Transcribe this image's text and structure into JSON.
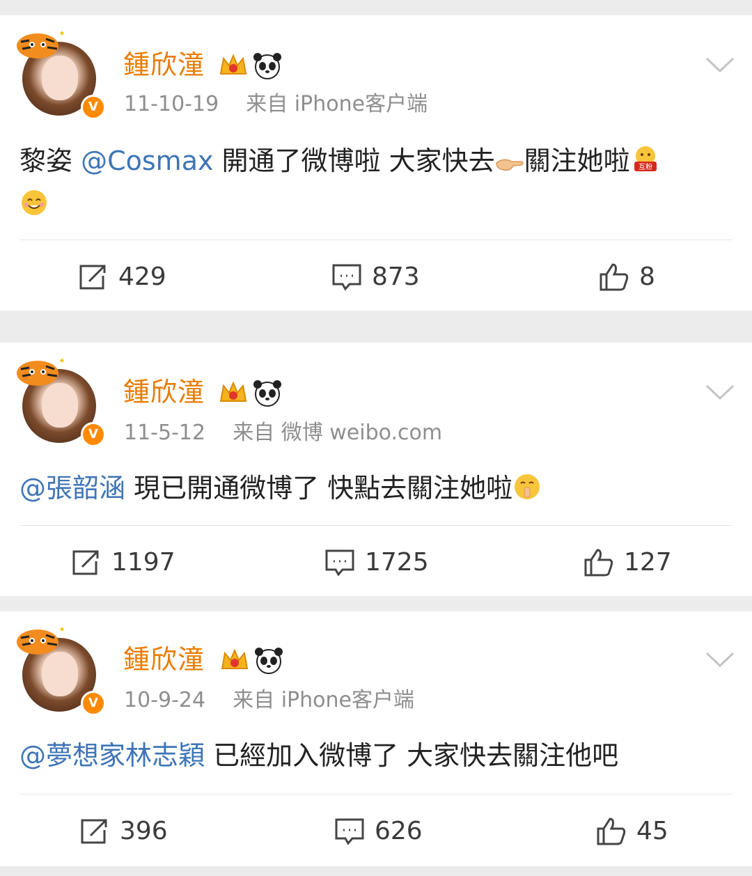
{
  "posts": [
    {
      "author": "鍾欣潼",
      "date": "11-10-19",
      "source": "来自 iPhone客户端",
      "mention": "@Cosmax",
      "text_before": "黎姿 ",
      "text_mid": " 開通了微博啦 大家快去",
      "text_after": "關注她啦",
      "reposts": "429",
      "comments": "873",
      "likes": "8"
    },
    {
      "author": "鍾欣潼",
      "date": "11-5-12",
      "source": "来自 微博 weibo.com",
      "mention": "@張韶涵",
      "text": " 現已開通微博了 快點去關注她啦",
      "reposts": "1197",
      "comments": "1725",
      "likes": "127"
    },
    {
      "author": "鍾欣潼",
      "date": "10-9-24",
      "source": "来自 iPhone客户端",
      "mention": "@夢想家林志穎",
      "text": " 已經加入微博了 大家快去關注他吧",
      "reposts": "396",
      "comments": "626",
      "likes": "45"
    }
  ],
  "icons": {
    "badge_crown": "crown-icon",
    "badge_panda": "panda-icon",
    "verified": "V",
    "menu": "chevron-down-icon",
    "repost": "repost-icon",
    "comment": "comment-icon",
    "like": "thumbs-up-icon"
  },
  "colors": {
    "author": "#ea7b00",
    "mention": "#3e75b6",
    "meta": "#8e8e8e",
    "verified": "#ff8a00"
  }
}
